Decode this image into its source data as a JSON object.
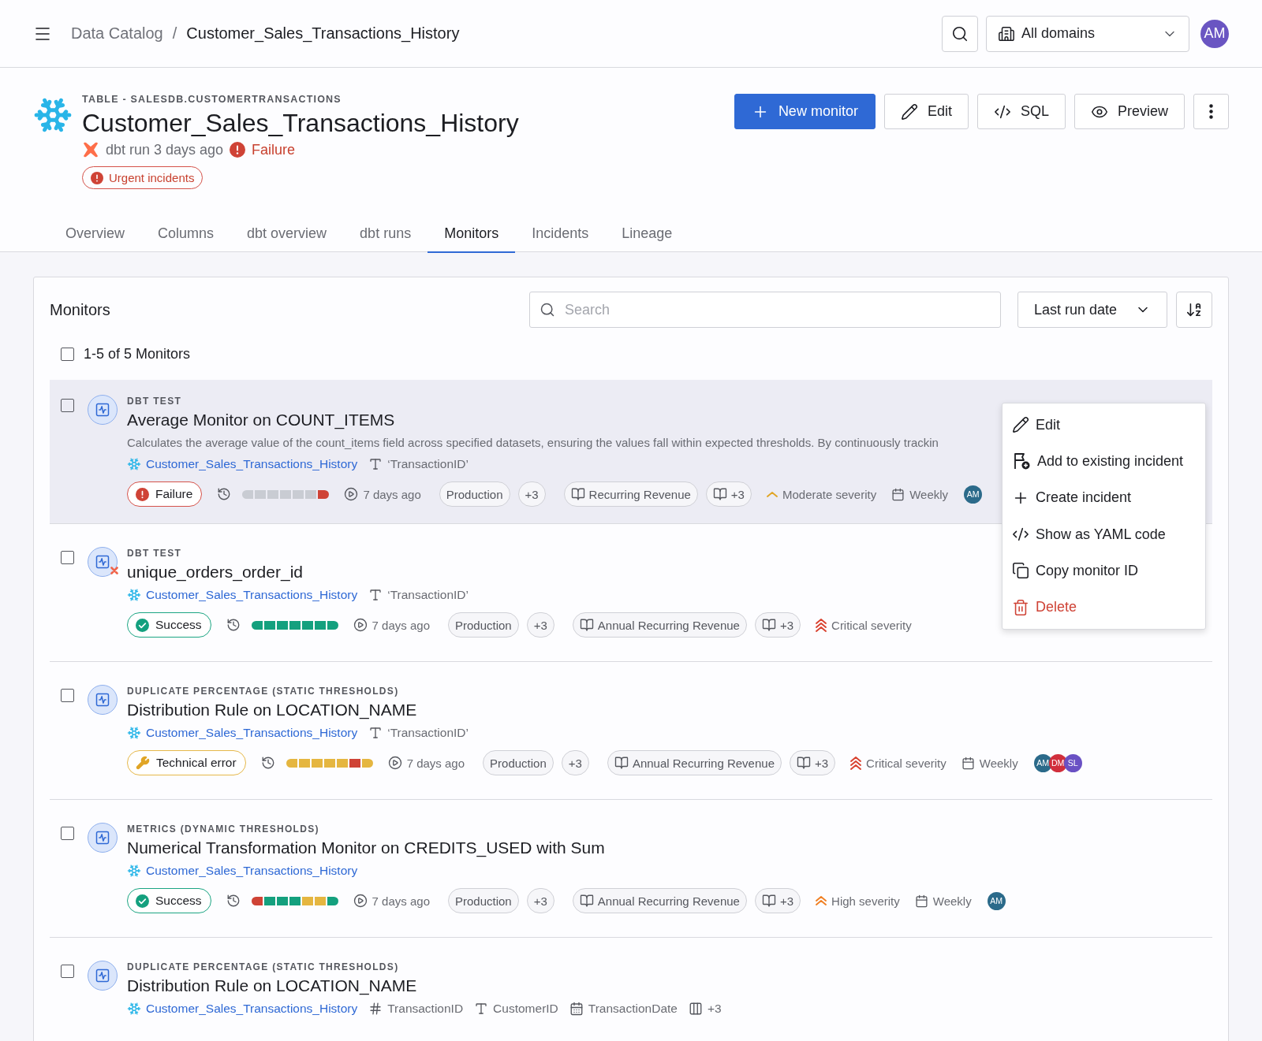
{
  "topbar": {
    "breadcrumb": [
      {
        "label": "Data Catalog",
        "current": false
      },
      {
        "label": "Customer_Sales_Transactions_History",
        "current": true
      }
    ],
    "separator": "/",
    "domain_select": {
      "value": "All domains"
    },
    "avatar": "AM"
  },
  "header": {
    "kind_label": "TABLE - SALESDB.CUSTOMERTRANSACTIONS",
    "title": "Customer_Sales_Transactions_History",
    "run": "dbt run 3 days ago",
    "status": "Failure",
    "incident_badge": "Urgent incidents",
    "actions": [
      {
        "kind": "primary",
        "label": "New monitor"
      },
      {
        "kind": "edit",
        "label": "Edit"
      },
      {
        "kind": "sql",
        "label": "SQL"
      },
      {
        "kind": "preview",
        "label": "Preview"
      },
      {
        "kind": "more"
      }
    ]
  },
  "tabs": [
    {
      "label": "Overview",
      "selected": false
    },
    {
      "label": "Columns",
      "selected": false
    },
    {
      "label": "dbt overview",
      "selected": false
    },
    {
      "label": "dbt runs",
      "selected": false
    },
    {
      "label": "Monitors",
      "selected": true
    },
    {
      "label": "Incidents",
      "selected": false
    },
    {
      "label": "Lineage",
      "selected": false
    }
  ],
  "monitors_panel": {
    "title": "Monitors",
    "search": {
      "placeholder": "Search"
    },
    "sort": {
      "value": "Last run date"
    },
    "select_all": {
      "checked": false
    },
    "count": "1-5 of 5 Monitors",
    "monitors": [
      {
        "checked": false,
        "highlighted": true,
        "error_mark": false,
        "type": "DBT TEST",
        "name": "Average Monitor on COUNT_ITEMS",
        "description": "Calculates the average value of the count_items field across specified datasets, ensuring the values fall within expected thresholds. By continuously trackin",
        "table": "Customer_Sales_Transactions_History",
        "columns": [
          {
            "kind": "text",
            "label": "‘TransactionID’"
          }
        ],
        "status": {
          "kind": "failure",
          "label": "Failure"
        },
        "history": [
          {
            "color": "#c9ccd3"
          },
          {
            "color": "#c9ccd3"
          },
          {
            "color": "#c9ccd3"
          },
          {
            "color": "#c9ccd3"
          },
          {
            "color": "#c9ccd3"
          },
          {
            "color": "#c9ccd3"
          },
          {
            "color": "#cf4336"
          }
        ],
        "last_run": "7 days ago",
        "environment": "Production",
        "environment_more": "+3",
        "product": "Recurring Revenue",
        "product_more": "+3",
        "severity": {
          "kind": "moderate",
          "label": "Moderate severity"
        },
        "schedule": "Weekly",
        "owners": [
          {
            "initials": "AM",
            "color": "#2b6a8a"
          }
        ]
      },
      {
        "checked": false,
        "highlighted": false,
        "error_mark": true,
        "type": "DBT TEST",
        "name": "unique_orders_order_id",
        "table": "Customer_Sales_Transactions_History",
        "columns": [
          {
            "kind": "text",
            "label": "‘TransactionID’"
          }
        ],
        "status": {
          "kind": "success",
          "label": "Success"
        },
        "history": [
          {
            "color": "#14a07e"
          },
          {
            "color": "#14a07e"
          },
          {
            "color": "#14a07e"
          },
          {
            "color": "#14a07e"
          },
          {
            "color": "#14a07e"
          },
          {
            "color": "#14a07e"
          },
          {
            "color": "#14a07e"
          }
        ],
        "last_run": "7 days ago",
        "environment": "Production",
        "environment_more": "+3",
        "product": "Annual Recurring Revenue",
        "product_more": "+3",
        "severity": {
          "kind": "critical",
          "label": "Critical severity"
        }
      },
      {
        "checked": false,
        "highlighted": false,
        "error_mark": false,
        "type": "DUPLICATE PERCENTAGE (STATIC THRESHOLDS)",
        "name": "Distribution Rule on LOCATION_NAME",
        "table": "Customer_Sales_Transactions_History",
        "columns": [
          {
            "kind": "text",
            "label": "‘TransactionID’"
          }
        ],
        "status": {
          "kind": "technical",
          "label": "Technical error"
        },
        "history": [
          {
            "color": "#e5b640"
          },
          {
            "color": "#e5b640"
          },
          {
            "color": "#e5b640"
          },
          {
            "color": "#e5b640"
          },
          {
            "color": "#e5b640"
          },
          {
            "color": "#cf4336"
          },
          {
            "color": "#e5b640"
          }
        ],
        "last_run": "7 days ago",
        "environment": "Production",
        "environment_more": "+3",
        "product": "Annual Recurring Revenue",
        "product_more": "+3",
        "severity": {
          "kind": "critical",
          "label": "Critical severity"
        },
        "schedule": "Weekly",
        "owners": [
          {
            "initials": "AM",
            "color": "#2b6a8a"
          },
          {
            "initials": "DM",
            "color": "#d12f3c"
          },
          {
            "initials": "SL",
            "color": "#6a51c4"
          }
        ]
      },
      {
        "checked": false,
        "highlighted": false,
        "error_mark": false,
        "type": "METRICS (DYNAMIC THRESHOLDS)",
        "name": "Numerical Transformation Monitor on CREDITS_USED with Sum",
        "table": "Customer_Sales_Transactions_History",
        "status": {
          "kind": "success",
          "label": "Success"
        },
        "history": [
          {
            "color": "#cf4336"
          },
          {
            "color": "#14a07e"
          },
          {
            "color": "#14a07e"
          },
          {
            "color": "#14a07e"
          },
          {
            "color": "#e5b640"
          },
          {
            "color": "#e5b640"
          },
          {
            "color": "#14a07e"
          }
        ],
        "last_run": "7 days ago",
        "environment": "Production",
        "environment_more": "+3",
        "product": "Annual Recurring Revenue",
        "product_more": "+3",
        "severity": {
          "kind": "high",
          "label": "High severity"
        },
        "schedule": "Weekly",
        "owners": [
          {
            "initials": "AM",
            "color": "#2b6a8a"
          }
        ]
      },
      {
        "checked": false,
        "highlighted": false,
        "error_mark": false,
        "type": "DUPLICATE PERCENTAGE (STATIC THRESHOLDS)",
        "name": "Distribution Rule on LOCATION_NAME",
        "table": "Customer_Sales_Transactions_History",
        "columns": [
          {
            "kind": "number",
            "label": "TransactionID"
          },
          {
            "kind": "text",
            "label": "CustomerID"
          },
          {
            "kind": "date",
            "label": "TransactionDate"
          },
          {
            "kind": "more",
            "label": "+3"
          }
        ]
      }
    ]
  },
  "context_menu": [
    {
      "kind": "edit",
      "label": "Edit"
    },
    {
      "kind": "add_incident",
      "label": "Add to existing incident"
    },
    {
      "kind": "create",
      "label": "Create incident"
    },
    {
      "kind": "yaml",
      "label": "Show as YAML code"
    },
    {
      "kind": "copy",
      "label": "Copy monitor ID"
    },
    {
      "kind": "delete",
      "label": "Delete"
    }
  ]
}
